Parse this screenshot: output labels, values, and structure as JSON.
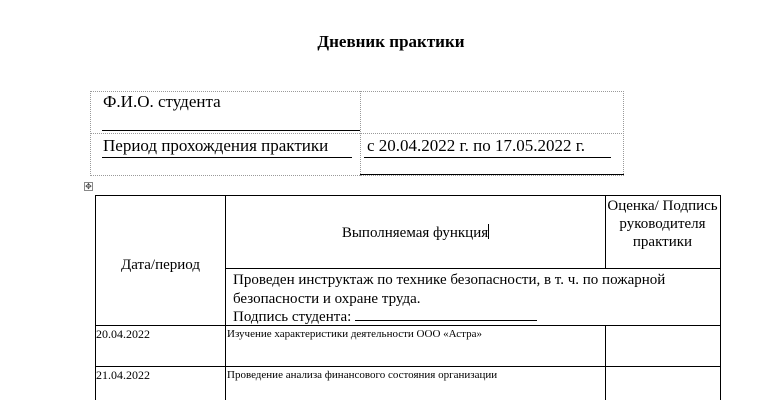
{
  "document": {
    "title": "Дневник практики",
    "info": {
      "student_label": "Ф.И.О. студента",
      "period_label": "Период прохождения практики",
      "period_value": "с 20.04.2022 г. по 17.05.2022 г."
    },
    "diary": {
      "headers": {
        "date": "Дата/период",
        "function": "Выполняемая функция",
        "grade": "Оценка/ Подпись руководителя практики"
      },
      "instruction": "Проведен инструктаж по технике безопасности, в т. ч. по пожарной безопасности и охране труда.",
      "signature_label": "Подпись студента:",
      "rows": [
        {
          "date": "20.04.2022",
          "function": "Изучение характеристики деятельности ООО «Астра»"
        },
        {
          "date": "21.04.2022",
          "function": "Проведение анализа финансового состояния организации"
        }
      ]
    }
  }
}
